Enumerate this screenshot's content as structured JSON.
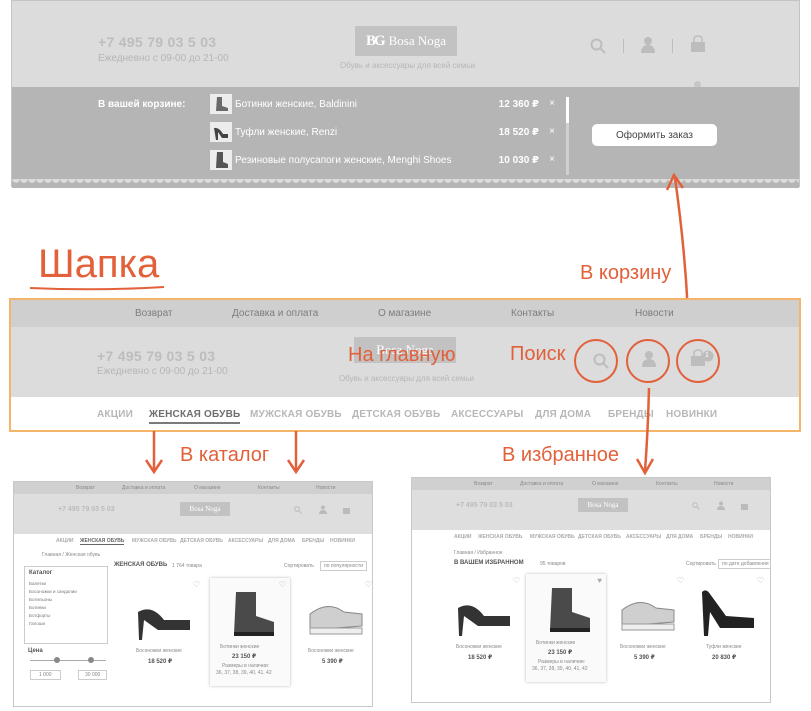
{
  "top": {
    "phone": "+7 495 79 03 5 03",
    "hours": "Ежедневно с 09-00 до 21-00",
    "logo": "Bosa Noga",
    "logo_mark": "BG",
    "tagline": "Обувь и аксессуары для всей семьи",
    "cart_title": "В вашей корзине:",
    "cart_items": [
      {
        "name": "Ботинки женские, Baldinini",
        "price": "12 360 ₽"
      },
      {
        "name": "Туфли женские, Renzi",
        "price": "18 520 ₽"
      },
      {
        "name": "Резиновые полусапоги женские, Menghi Shoes",
        "price": "10 030 ₽"
      }
    ],
    "remove_symbol": "×",
    "order_button": "Оформить заказ"
  },
  "annotations": {
    "header": "Шапка",
    "to_cart": "В корзину",
    "to_home": "На главную",
    "search": "Поиск",
    "to_catalog": "В каталог",
    "to_favorites": "В избранное"
  },
  "header": {
    "nav": [
      "Возврат",
      "Доставка и оплата",
      "О магазине",
      "Контакты",
      "Новости"
    ],
    "phone": "+7 495 79 03 5 03",
    "hours": "Ежедневно с 09-00 до 21-00",
    "logo": "Bosa Noga",
    "tagline": "Обувь и аксессуары для всей семьи",
    "categories": [
      "АКЦИИ",
      "ЖЕНСКАЯ ОБУВЬ",
      "МУЖСКАЯ ОБУВЬ",
      "ДЕТСКАЯ ОБУВЬ",
      "АКСЕССУАРЫ",
      "ДЛЯ ДОМА",
      "БРЕНДЫ",
      "НОВИНКИ"
    ],
    "active_category": "ЖЕНСКАЯ ОБУВЬ",
    "cart_count": "1"
  },
  "catalog_shot": {
    "nav": [
      "Возврат",
      "Доставка и оплата",
      "О магазине",
      "Контакты",
      "Новости"
    ],
    "phone": "+7 495 79 03 5 03",
    "logo": "Bosa Noga",
    "categories": [
      "АКЦИИ",
      "ЖЕНСКАЯ ОБУВЬ",
      "МУЖСКАЯ ОБУВЬ",
      "ДЕТСКАЯ ОБУВЬ",
      "АКСЕССУАРЫ",
      "ДЛЯ ДОМА",
      "БРЕНДЫ",
      "НОВИНКИ"
    ],
    "breadcrumb": "Главная  /  Женская обувь",
    "heading": "ЖЕНСКАЯ ОБУВЬ",
    "count": "1 764 товара",
    "sort_label": "Сортировать",
    "sort_value": "по популярности",
    "filter_title": "Каталог",
    "filter_items": [
      "Балетки",
      "Босоножки и сандалии",
      "Ботильоны",
      "Ботинки",
      "Ботфорты",
      "Галоши"
    ],
    "price_title": "Цена",
    "price_from": "1 000",
    "price_to": "30 000",
    "products": [
      {
        "name": "Босоножки женские",
        "price": "18 520 ₽"
      },
      {
        "name": "Ботинки женские",
        "price": "23 150 ₽",
        "sizes_label": "Размеры в наличии:",
        "sizes": "36, 37, 38, 39, 40, 41, 42"
      },
      {
        "name": "Босоножки женские",
        "price": "5 390 ₽"
      }
    ]
  },
  "favorites_shot": {
    "nav": [
      "Возврат",
      "Доставка и оплата",
      "О магазине",
      "Контакты",
      "Новости"
    ],
    "phone": "+7 495 79 03 5 03",
    "logo": "Bosa Noga",
    "categories": [
      "АКЦИИ",
      "ЖЕНСКАЯ ОБУВЬ",
      "МУЖСКАЯ ОБУВЬ",
      "ДЕТСКАЯ ОБУВЬ",
      "АКСЕССУАРЫ",
      "ДЛЯ ДОМА",
      "БРЕНДЫ",
      "НОВИНКИ"
    ],
    "breadcrumb": "Главная  /  Избранное",
    "heading": "В ВАШЕМ ИЗБРАННОМ",
    "count": "95 товаров",
    "sort_label": "Сортировать",
    "sort_value": "по дате добавления",
    "products": [
      {
        "name": "Босоножки женские",
        "price": "18 520 ₽"
      },
      {
        "name": "Ботинки женские",
        "price": "23 150 ₽",
        "sizes_label": "Размеры в наличии:",
        "sizes": "36, 37, 38, 39, 40, 41, 42"
      },
      {
        "name": "Босоножки женские",
        "price": "5 390 ₽"
      },
      {
        "name": "Туфли женские",
        "price": "20 830 ₽"
      }
    ]
  },
  "colors": {
    "accent": "#e2603a",
    "frame": "#f4b56b"
  }
}
